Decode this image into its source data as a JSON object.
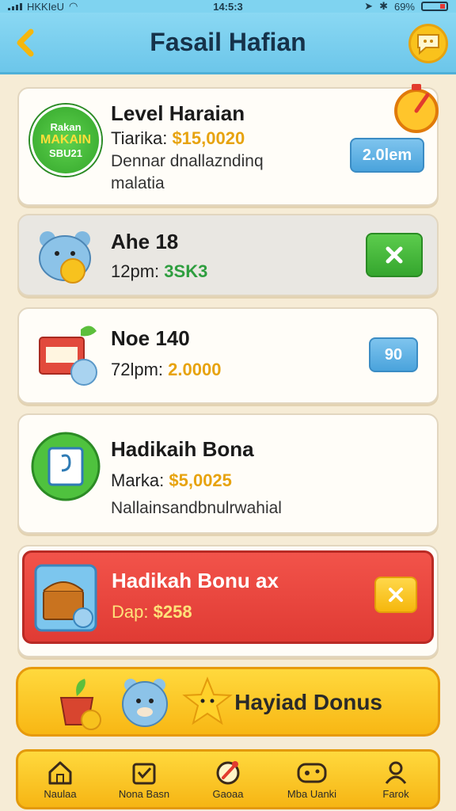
{
  "status_bar": {
    "carrier": "HKKIeU",
    "time": "14:5:3",
    "battery": "69%"
  },
  "header": {
    "title": "Fasail Hafian",
    "back_icon": "chevron-left-icon",
    "chat_icon": "chat-bubble-icon"
  },
  "cards": [
    {
      "icon_text": [
        "Rakan",
        "MAKAIN",
        "SBU21"
      ],
      "title": "Level Haraian",
      "sub_prefix": "Tiarika:",
      "sub_value": "$15,0020",
      "desc_line1": "Dennar dnallazndinq",
      "desc_line2": "malatia",
      "button_label": "2.0lem"
    },
    {
      "title": "Ahe 18",
      "sub_prefix": "12pm:",
      "sub_value": "3SK3"
    },
    {
      "title": "Noe 140",
      "sub_prefix": "72lpm:",
      "sub_value": "2.0000",
      "button_label": "90"
    },
    {
      "title": "Hadikaih Bona",
      "sub_prefix": "Marka:",
      "sub_value": "$5,0025",
      "desc": "Nallainsandbnulrwahial"
    },
    {
      "title": "Hadikah Bonu ax",
      "sub_prefix": "Dap:",
      "sub_value": "$258"
    }
  ],
  "big_button": {
    "label": "Hayiad Donus"
  },
  "bottom_nav": [
    {
      "label": "Naulaa",
      "icon": "home-icon"
    },
    {
      "label": "Nona Basn",
      "icon": "gift-box-icon"
    },
    {
      "label": "Gaoaa",
      "icon": "compass-icon"
    },
    {
      "label": "Mba Uanki",
      "icon": "gamepad-icon"
    },
    {
      "label": "Farok",
      "icon": "profile-icon"
    }
  ],
  "colors": {
    "header": "#7fd3f0",
    "gold": "#e7a30f",
    "green_value": "#2e9e3f",
    "red_card": "#e03b34",
    "yellow_button": "#f8b714"
  }
}
